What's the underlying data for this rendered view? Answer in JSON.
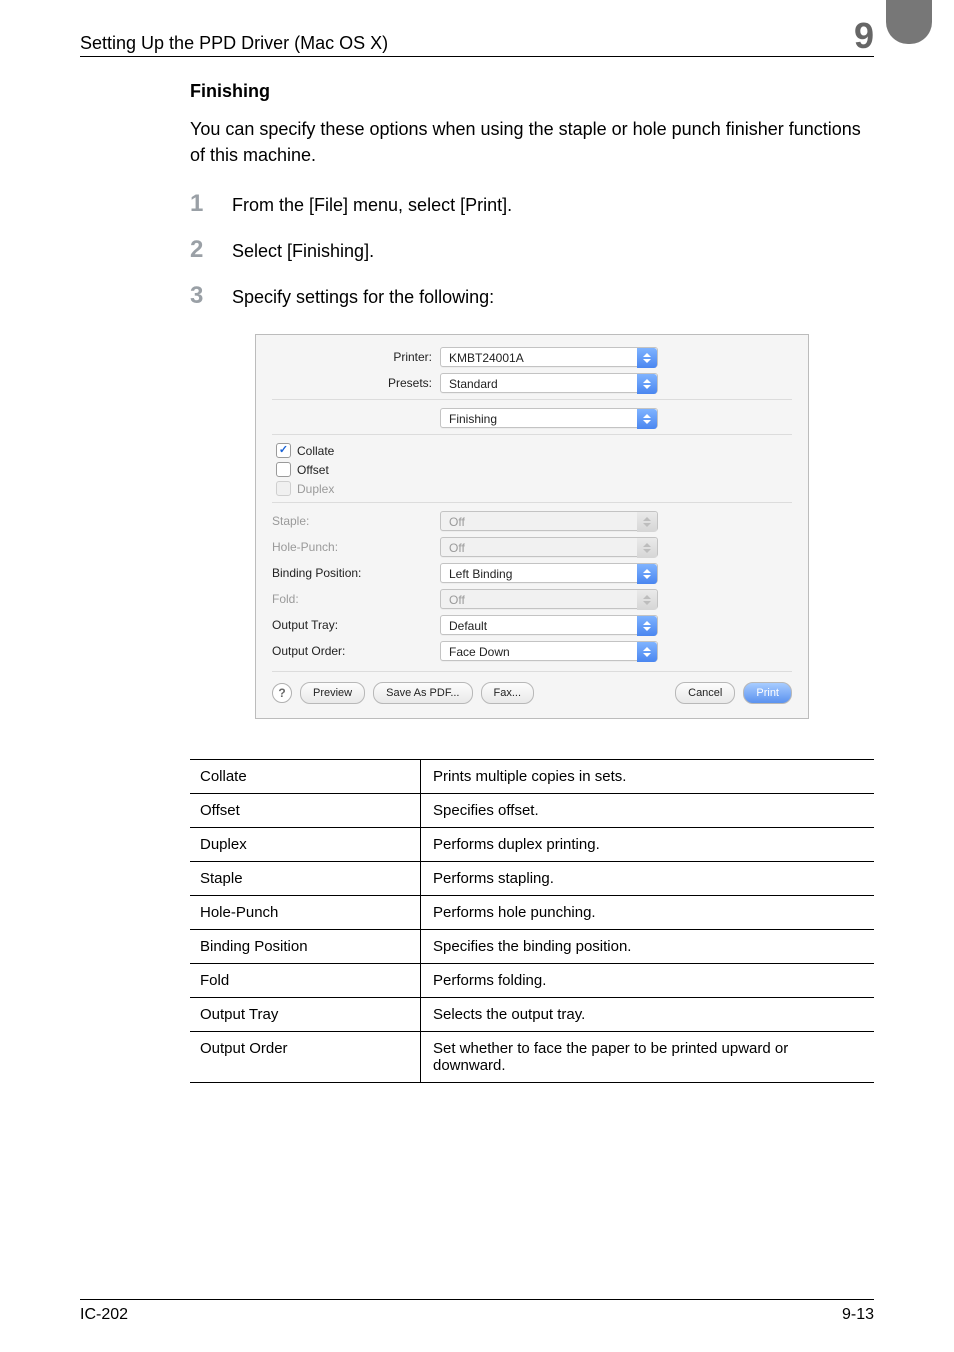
{
  "header": {
    "title": "Setting Up the PPD Driver (Mac OS X)",
    "chapter": "9"
  },
  "section": {
    "heading": "Finishing",
    "lead": "You can specify these options when using the staple or hole punch finisher functions of this machine."
  },
  "steps": [
    {
      "num": "1",
      "text": "From the [File] menu, select [Print]."
    },
    {
      "num": "2",
      "text": "Select [Finishing]."
    },
    {
      "num": "3",
      "text": "Specify settings for the following:"
    }
  ],
  "dialog": {
    "labels": {
      "printer": "Printer:",
      "presets": "Presets:",
      "collate": "Collate",
      "offset": "Offset",
      "duplex": "Duplex",
      "staple": "Staple:",
      "hole_punch": "Hole-Punch:",
      "binding": "Binding Position:",
      "fold": "Fold:",
      "output_tray": "Output Tray:",
      "output_order": "Output Order:"
    },
    "values": {
      "printer": "KMBT24001A",
      "presets": "Standard",
      "panel": "Finishing",
      "staple": "Off",
      "hole_punch": "Off",
      "binding": "Left Binding",
      "fold": "Off",
      "output_tray": "Default",
      "output_order": "Face Down"
    },
    "checkboxes": {
      "collate": true,
      "offset": false,
      "duplex": false
    },
    "buttons": {
      "help": "?",
      "preview": "Preview",
      "save_pdf": "Save As PDF...",
      "fax": "Fax...",
      "cancel": "Cancel",
      "print": "Print"
    }
  },
  "table": [
    {
      "name": "Collate",
      "desc": "Prints multiple copies in sets."
    },
    {
      "name": "Offset",
      "desc": "Specifies offset."
    },
    {
      "name": "Duplex",
      "desc": "Performs duplex printing."
    },
    {
      "name": "Staple",
      "desc": "Performs stapling."
    },
    {
      "name": "Hole-Punch",
      "desc": "Performs hole punching."
    },
    {
      "name": "Binding Position",
      "desc": "Specifies the binding position."
    },
    {
      "name": "Fold",
      "desc": "Performs folding."
    },
    {
      "name": "Output Tray",
      "desc": "Selects the output tray."
    },
    {
      "name": "Output Order",
      "desc": "Set whether to face the paper to be printed upward or downward."
    }
  ],
  "footer": {
    "left": "IC-202",
    "right": "9-13"
  }
}
